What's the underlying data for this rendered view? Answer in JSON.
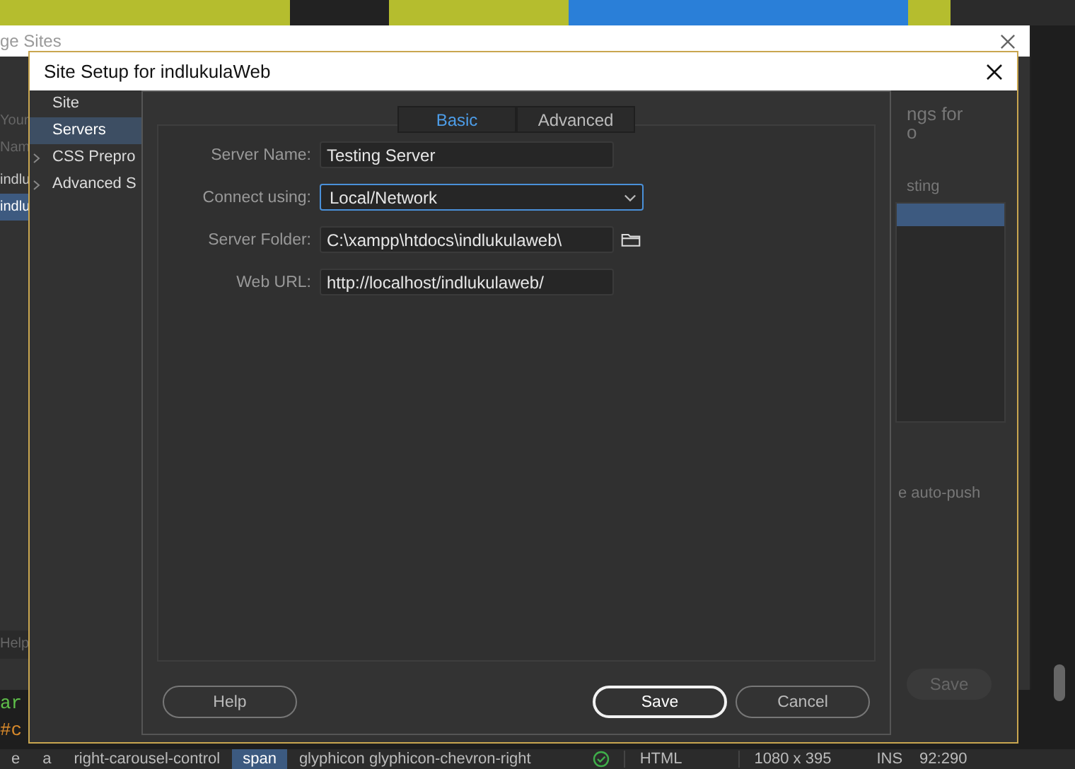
{
  "manage_sites": {
    "title": "ge Sites",
    "intro": "Your",
    "column_header": "Nam",
    "sites": [
      {
        "name": "indlu",
        "selected": false
      },
      {
        "name": "indlu",
        "selected": true
      }
    ],
    "help": "Help"
  },
  "code_lines": [
    {
      "text": "ar",
      "kind": "keyword"
    },
    {
      "text": "#c",
      "kind": "selector"
    }
  ],
  "site_setup": {
    "title": "Site Setup for indlukulaWeb",
    "right_heading": "ngs for",
    "right_subtext": "o",
    "tab_fragment": "sting",
    "auto_push": "e auto-push",
    "save": "Save",
    "sidebar": [
      {
        "label": "Site",
        "selected": false,
        "kind": "plain"
      },
      {
        "label": "Servers",
        "selected": true,
        "kind": "plain"
      },
      {
        "label": "CSS Prepro",
        "selected": false,
        "kind": "expandable"
      },
      {
        "label": "Advanced S",
        "selected": false,
        "kind": "expandable"
      }
    ]
  },
  "server_dialog": {
    "tabs": [
      {
        "label": "Basic",
        "selected": true
      },
      {
        "label": "Advanced",
        "selected": false
      }
    ],
    "fields": [
      {
        "label": "Server Name:",
        "value": "Testing Server",
        "kind": "text"
      },
      {
        "label": "Connect using:",
        "value": "Local/Network",
        "kind": "select"
      },
      {
        "label": "Server Folder:",
        "value": "C:\\xampp\\htdocs\\indlukulaweb\\",
        "kind": "folder"
      },
      {
        "label": "Web URL:",
        "value": "http://localhost/indlukulaweb/",
        "kind": "text"
      }
    ],
    "buttons": [
      {
        "label": "Help",
        "kind": "help"
      },
      {
        "label": "Save",
        "kind": "primary"
      },
      {
        "label": "Cancel",
        "kind": "secondary"
      }
    ]
  },
  "status_bar": {
    "breadcrumbs": [
      {
        "label": "e",
        "selected": false
      },
      {
        "label": "a",
        "selected": false
      },
      {
        "label": "right-carousel-control",
        "selected": false
      },
      {
        "label": "span",
        "selected": true
      },
      {
        "label": "glyphicon glyphicon-chevron-right",
        "selected": false
      }
    ],
    "language": "HTML",
    "size": "1080 x 395",
    "mode": "INS",
    "position": "92:290"
  }
}
